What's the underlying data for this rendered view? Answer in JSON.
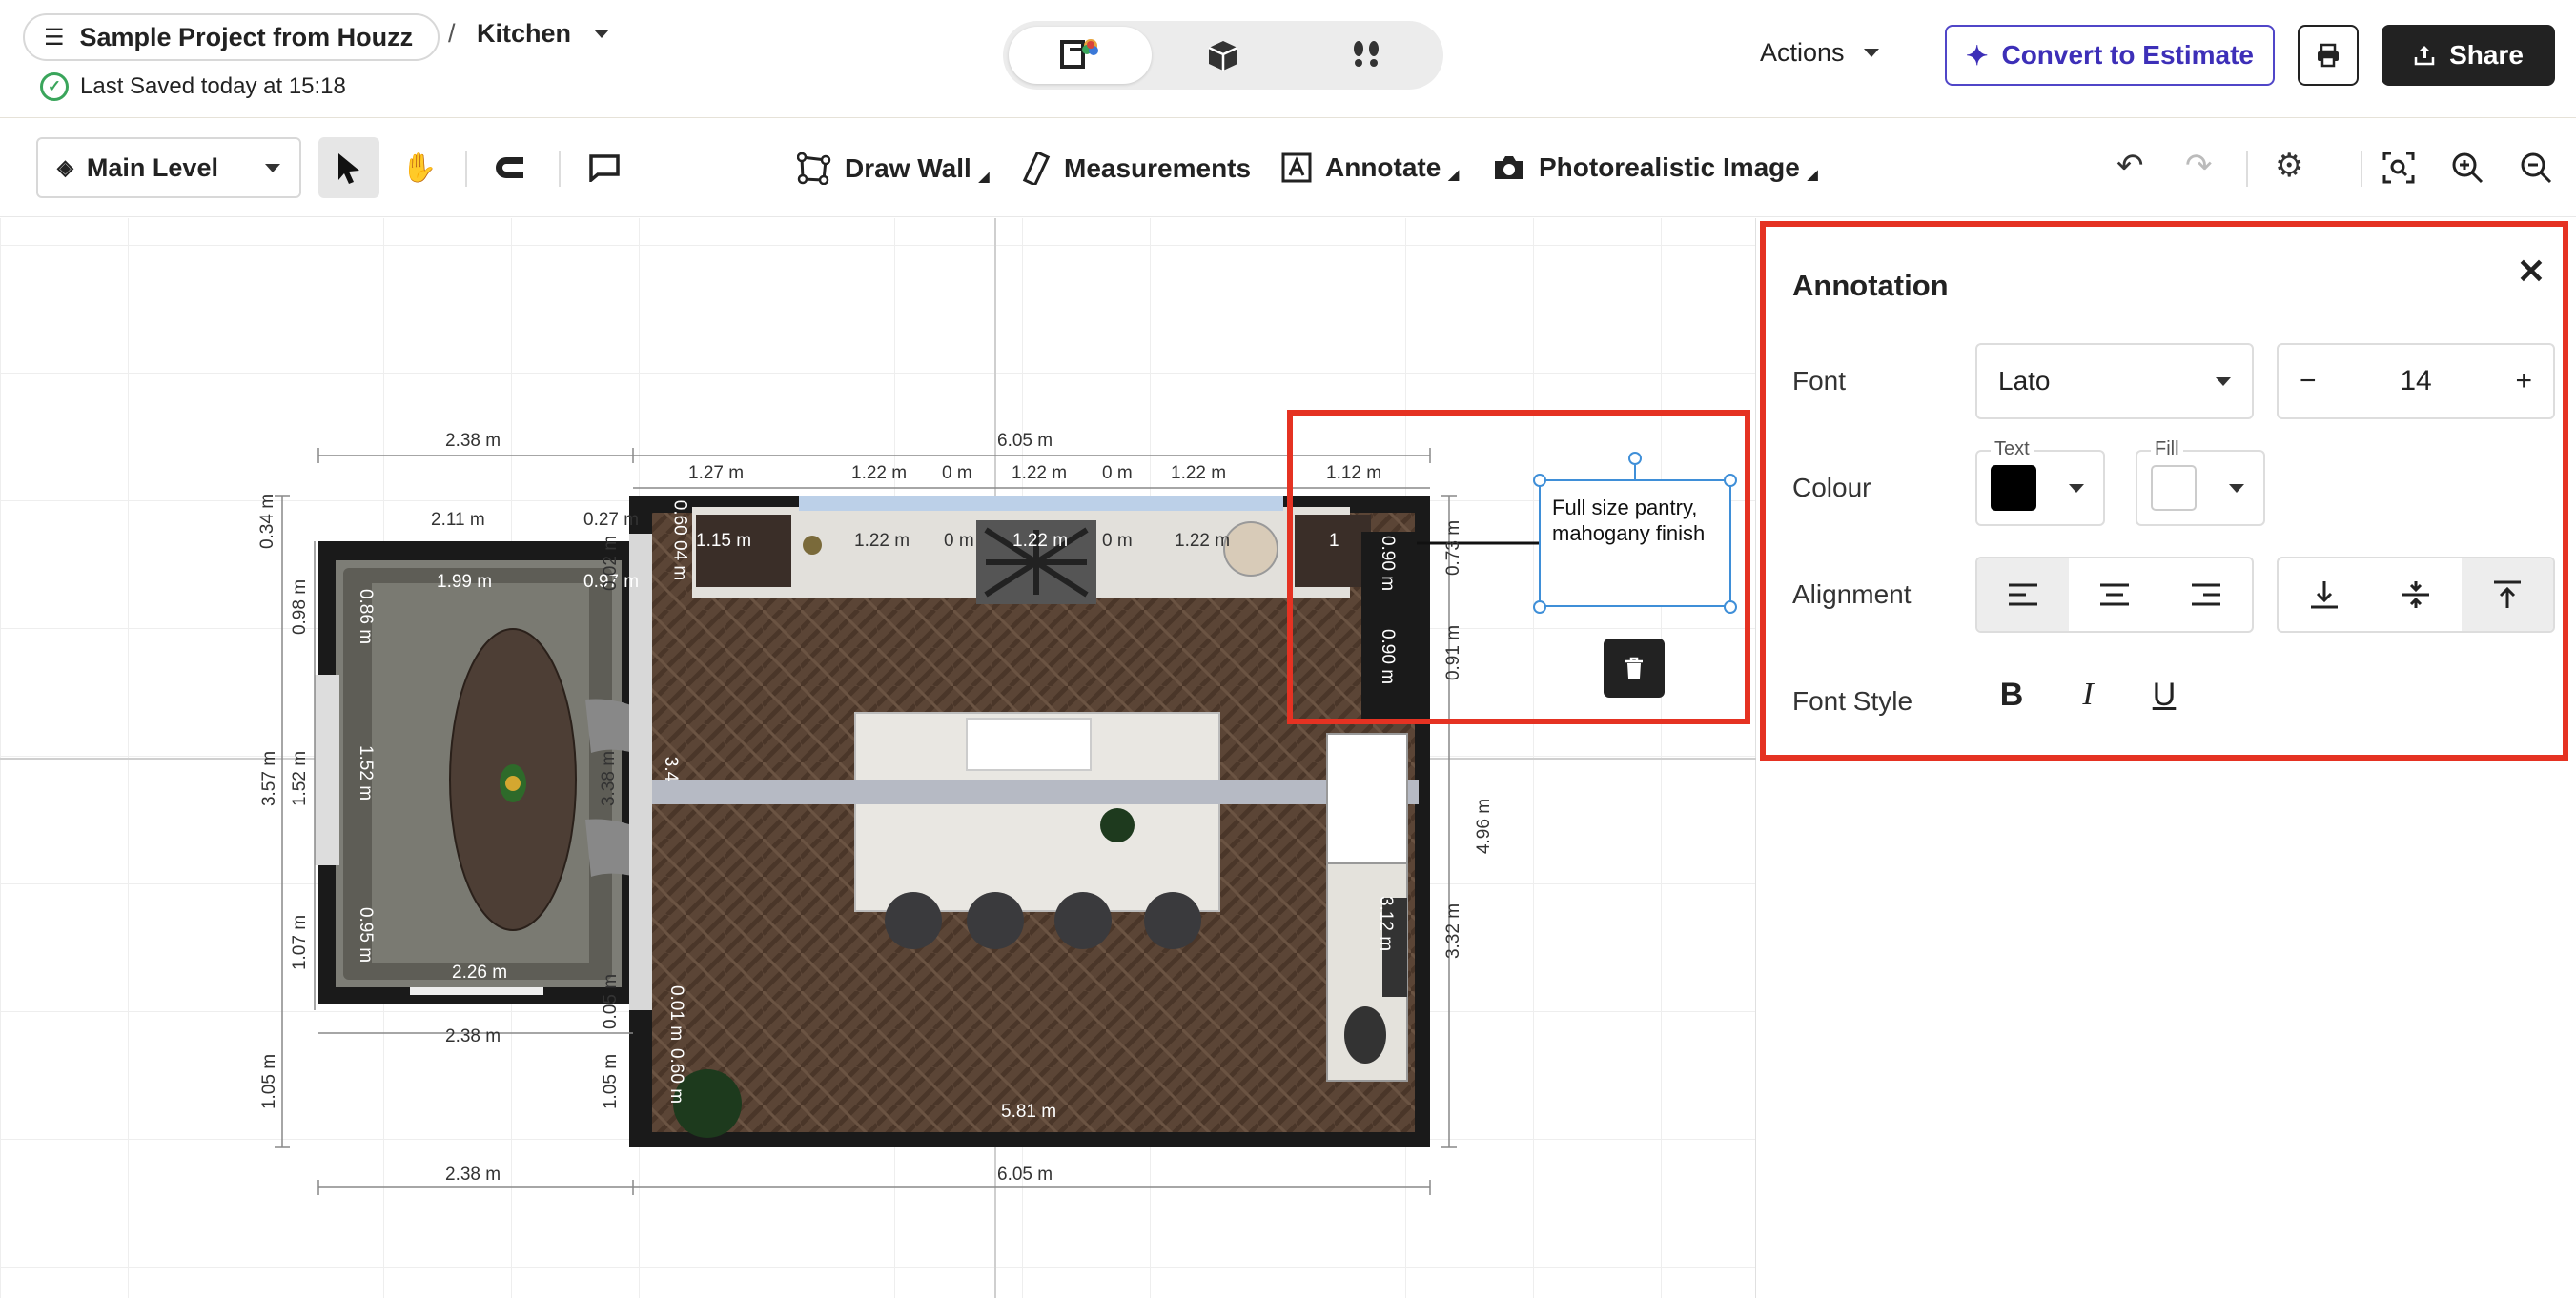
{
  "header": {
    "project_name": "Sample Project from Houzz",
    "separator": "/",
    "room_name": "Kitchen",
    "saved_status": "Last Saved today at 15:18",
    "actions_label": "Actions",
    "convert_label": "Convert to Estimate",
    "share_label": "Share",
    "view_modes": [
      "2d-plan-icon",
      "3d-box-icon",
      "walkthrough-footsteps-icon"
    ]
  },
  "toolbar": {
    "level_label": "Main Level",
    "draw_wall_label": "Draw Wall",
    "measurements_label": "Measurements",
    "annotate_label": "Annotate",
    "photo_label": "Photorealistic Image"
  },
  "annotation_panel": {
    "title": "Annotation",
    "font_label": "Font",
    "font_value": "Lato",
    "size_value": "14",
    "colour_label": "Colour",
    "text_color_label": "Text",
    "fill_color_label": "Fill",
    "text_color": "#000000",
    "fill_color": "#ffffff",
    "alignment_label": "Alignment",
    "font_style_label": "Font Style",
    "bold": "B",
    "italic": "I",
    "underline": "U"
  },
  "annotation": {
    "text": "Full size pantry, mahogany finish"
  },
  "dimensions": {
    "top_overall_left": "2.38 m",
    "top_overall_right": "6.05 m",
    "top_127": "1.27 m",
    "top_122a": "1.22 m",
    "top_0a": "0 m",
    "top_122b": "1.22 m",
    "top_0b": "0 m",
    "top_122c": "1.22 m",
    "top_112": "1.12 m",
    "dining_211": "2.11 m",
    "dining_027": "0.27 m",
    "dining_199": "1.99 m",
    "dining_097": "0.97 m",
    "dining_226": "2.26 m",
    "bottom_238": "2.38 m",
    "bottom_238b": "2.38 m",
    "bottom_605": "6.05 m",
    "kitchen_581": "5.81 m",
    "counter_115": "1.15 m",
    "counter_122": "1.22 m",
    "counter_0a": "0 m",
    "counter_122b": "1.22 m",
    "counter_0b": "0 m",
    "counter_122c": "1.22 m",
    "counter_1": "1",
    "left_034": "0.34 m",
    "left_098": "0.98 m",
    "left_357": "3.57 m",
    "left_152": "1.52 m",
    "left_107": "1.07 m",
    "left_105": "1.05 m",
    "inner_086": "0.86 m",
    "inner_152": "1.52 m",
    "inner_095": "0.95 m",
    "wall_338": "3.38 m",
    "wall_34": "3.4",
    "wall_105": "1.05 m",
    "wall_005": "0.05 m",
    "wall_002": "0.02 m",
    "wall_0604": "0.60 04 m",
    "wall_001": "0.01 m",
    "wall_060": "0.60 m",
    "right_073": "0.73 m",
    "right_091": "0.91 m",
    "right_496": "4.96 m",
    "right_332": "3.32 m",
    "inner_090": "0.90 m",
    "inner_0901": "0.90 m",
    "inner_312": "3.12 m"
  },
  "colors": {
    "accent": "#5046c8",
    "highlight": "#e53222",
    "selection": "#3f8fd8",
    "wall": "#1a1a1a",
    "floor": "#5b4536"
  }
}
